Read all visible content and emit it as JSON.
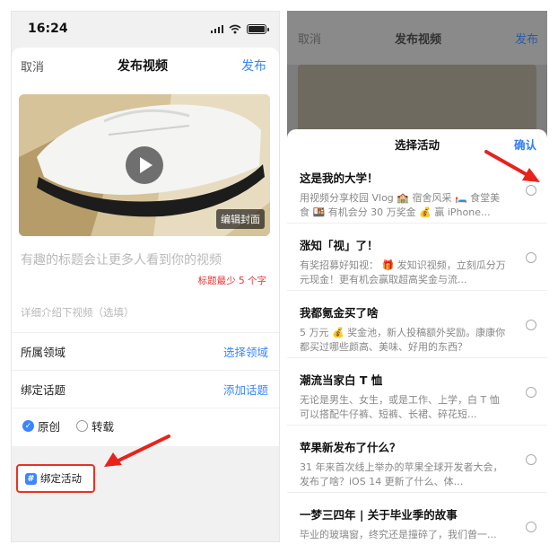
{
  "left": {
    "status": {
      "time": "16:24"
    },
    "header": {
      "cancel": "取消",
      "title": "发布视频",
      "publish": "发布"
    },
    "video": {
      "edit_cover": "编辑封面"
    },
    "title_placeholder": "有趣的标题会让更多人看到你的视频",
    "title_min": "标题最少 5 个字",
    "desc_placeholder": "详细介绍下视频（选填）",
    "rows": [
      {
        "label": "所属领域",
        "action": "选择领域"
      },
      {
        "label": "绑定话题",
        "action": "添加话题"
      }
    ],
    "origin": {
      "original": "原创",
      "repost": "转载"
    },
    "bind_activity": "绑定活动"
  },
  "right": {
    "header": {
      "cancel": "取消",
      "title": "发布视频",
      "publish": "发布"
    },
    "sheet": {
      "title": "选择活动",
      "confirm": "确认",
      "items": [
        {
          "title": "这是我的大学！",
          "desc": "用视频分享校园 Vlog 🏫 宿舍风采 🛏️ 食堂美食 🍱 有机会分 30 万奖金 💰 赢 iPhone..."
        },
        {
          "title": "涨知「视」了！",
          "desc": "有奖招募好知视： 🎁 发知识视频，立刻瓜分万元现金！更有机会赢取超高奖金与流..."
        },
        {
          "title": "我都氪金买了啥",
          "desc": "5 万元 💰 奖金池，新人投稿额外奖励。康康你都买过哪些颜高、美味、好用的东西？"
        },
        {
          "title": "潮流当家白 T 恤",
          "desc": "无论是男生、女生，或是工作、上学，白 T 恤可以搭配牛仔裤、短裤、长裙、碎花短..."
        },
        {
          "title": "苹果新发布了什么？",
          "desc": "31 年来首次线上举办的苹果全球开发者大会，发布了啥？iOS 14 更新了什么、体..."
        },
        {
          "title": "一梦三四年 | 关于毕业季的故事",
          "desc": "毕业的玻璃窗，终究还是撞碎了，我们曾一..."
        }
      ]
    }
  }
}
